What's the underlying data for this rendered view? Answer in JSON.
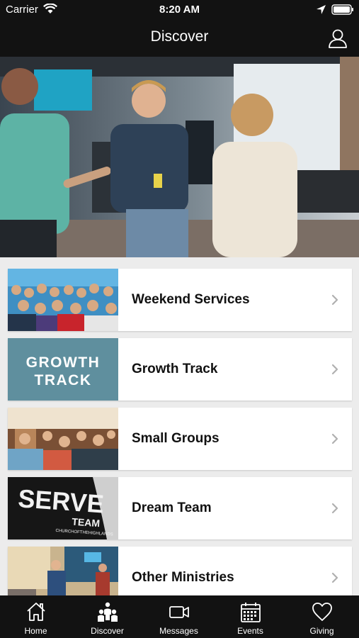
{
  "status_bar": {
    "carrier": "Carrier",
    "time": "8:20 AM"
  },
  "nav": {
    "title": "Discover"
  },
  "hero": {
    "icon": "hero-photo"
  },
  "cards": [
    {
      "label": "Weekend Services",
      "thumb": "congregation-photo"
    },
    {
      "label": "Growth Track",
      "thumb": "growth-track-banner",
      "thumb_text_line1": "GROWTH",
      "thumb_text_line2": "TRACK",
      "thumb_color": "#5f8f9e"
    },
    {
      "label": "Small Groups",
      "thumb": "small-groups-photo"
    },
    {
      "label": "Dream Team",
      "thumb": "serve-team-shirt",
      "thumb_text_line1": "SERVE",
      "thumb_text_line2": "TEAM",
      "thumb_text_line3": "CHURCHOFTHEHIGHLANDS"
    },
    {
      "label": "Other Ministries",
      "thumb": "ministries-photo"
    }
  ],
  "tabs": [
    {
      "label": "Home",
      "icon": "home-icon"
    },
    {
      "label": "Discover",
      "icon": "people-icon"
    },
    {
      "label": "Messages",
      "icon": "video-camera-icon"
    },
    {
      "label": "Events",
      "icon": "calendar-icon"
    },
    {
      "label": "Giving",
      "icon": "heart-icon"
    }
  ],
  "colors": {
    "bar_background": "#121212",
    "list_background": "#ececec"
  }
}
